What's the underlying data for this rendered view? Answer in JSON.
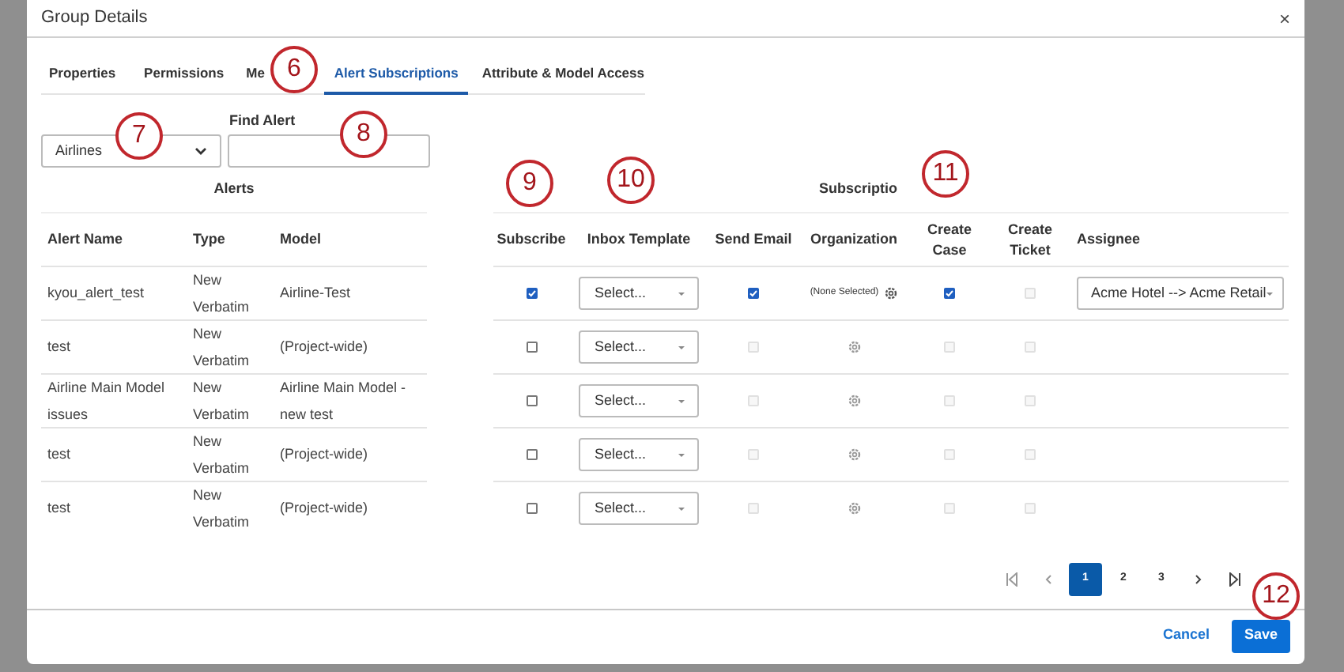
{
  "dialog": {
    "title": "Group Details",
    "close": "×"
  },
  "tabs": [
    {
      "label": "Properties",
      "selected": false
    },
    {
      "label": "Permissions",
      "selected": false
    },
    {
      "label": "Me",
      "selected": false
    },
    {
      "label": "Alert Subscriptions",
      "selected": true
    },
    {
      "label": "Attribute & Model Access",
      "selected": false
    }
  ],
  "filter": {
    "dropdown_value": "Airlines",
    "find_label": "Find Alert"
  },
  "alerts": {
    "title": "Alerts",
    "columns": [
      "Alert Name",
      "Type",
      "Model"
    ],
    "rows": [
      [
        "kyou_alert_test",
        "New Verbatim",
        "Airline-Test"
      ],
      [
        "test",
        "New Verbatim",
        "(Project-wide)"
      ],
      [
        "Airline Main Model issues",
        "New Verbatim",
        "Airline Main Model - new test"
      ],
      [
        "test",
        "New Verbatim",
        "(Project-wide)"
      ],
      [
        "test",
        "New Verbatim",
        "(Project-wide)"
      ]
    ]
  },
  "subscriptions": {
    "title": "Subscriptio",
    "columns": [
      "Subscribe",
      "Inbox Template",
      "Send Email",
      "Organization",
      "Create Case",
      "Create Ticket",
      "Assignee"
    ],
    "rows": [
      {
        "subscribe": true,
        "template": "Select...",
        "send_email": {
          "checked": true,
          "disabled": false
        },
        "organization": "(None Selected)",
        "create_case": {
          "checked": true,
          "disabled": false
        },
        "create_ticket": {
          "checked": false,
          "disabled": true
        },
        "assignee": "Acme Hotel --> Acme Retail"
      },
      {
        "subscribe": false,
        "template": "Select...",
        "send_email": {
          "checked": false,
          "disabled": true
        },
        "create_case": {
          "checked": false,
          "disabled": true
        },
        "create_ticket": {
          "checked": false,
          "disabled": true
        }
      },
      {
        "subscribe": false,
        "template": "Select...",
        "send_email": {
          "checked": false,
          "disabled": true
        },
        "create_case": {
          "checked": false,
          "disabled": true
        },
        "create_ticket": {
          "checked": false,
          "disabled": true
        }
      },
      {
        "subscribe": false,
        "template": "Select...",
        "send_email": {
          "checked": false,
          "disabled": true
        },
        "create_case": {
          "checked": false,
          "disabled": true
        },
        "create_ticket": {
          "checked": false,
          "disabled": true
        }
      },
      {
        "subscribe": false,
        "template": "Select...",
        "send_email": {
          "checked": false,
          "disabled": true
        },
        "create_case": {
          "checked": false,
          "disabled": true
        },
        "create_ticket": {
          "checked": false,
          "disabled": true
        }
      }
    ]
  },
  "pagination": [
    {
      "label": "1",
      "selected": true
    },
    {
      "label": "2",
      "selected": false
    },
    {
      "label": "3",
      "selected": false
    }
  ],
  "footer": {
    "cancel": "Cancel",
    "save": "Save"
  },
  "callouts": [
    "6",
    "7",
    "8",
    "9",
    "10",
    "11",
    "12"
  ]
}
